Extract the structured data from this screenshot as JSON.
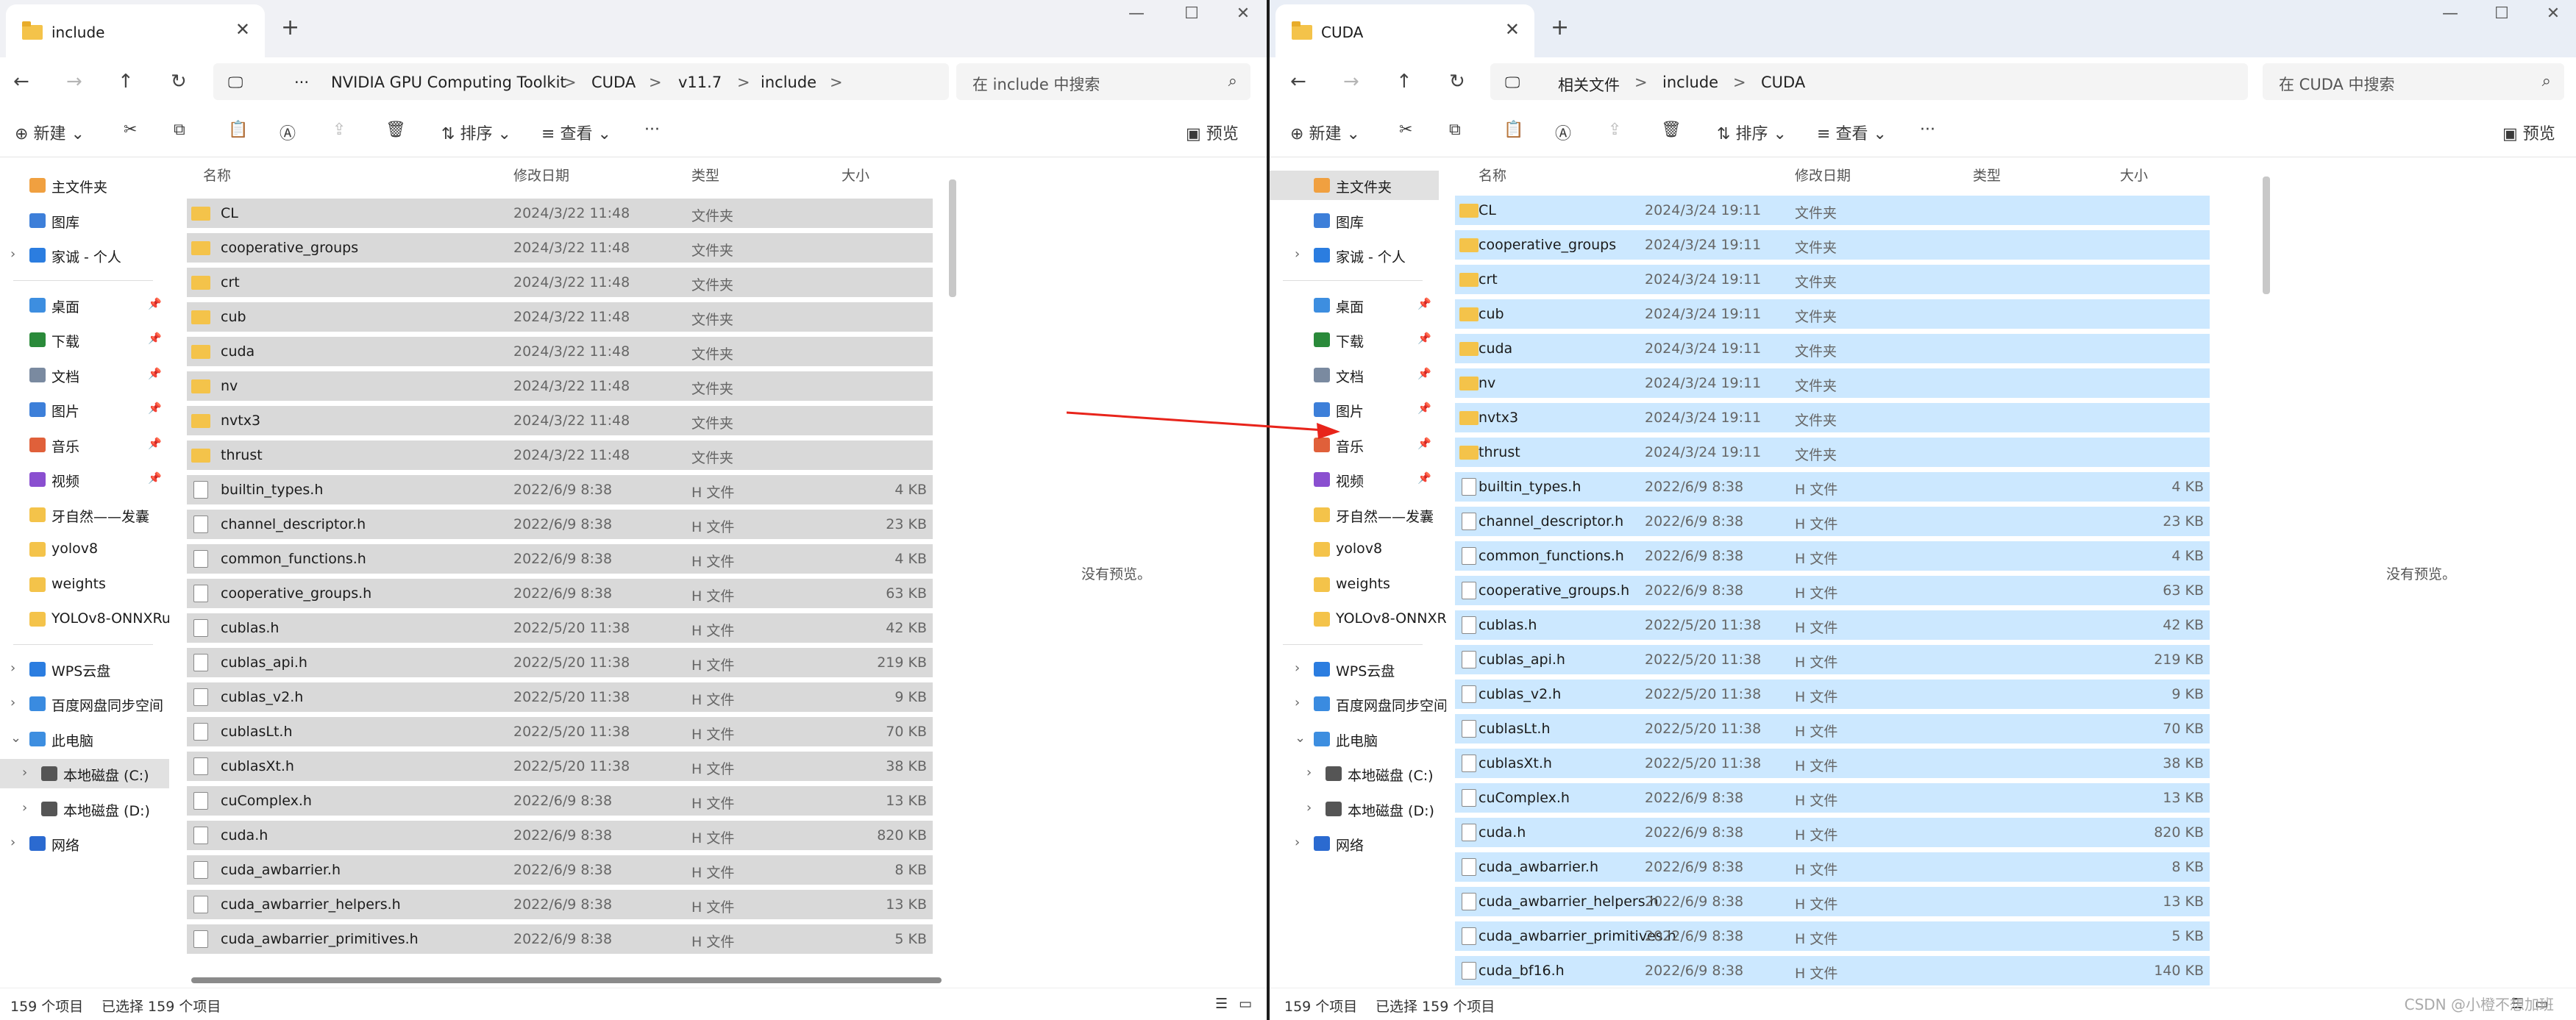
{
  "left_window": {
    "tab_title": "include",
    "breadcrumb": [
      "NVIDIA GPU Computing Toolkit",
      "CUDA",
      "v11.7",
      "include"
    ],
    "search_placeholder": "在 include 中搜索",
    "no_preview": "没有预览。",
    "status_count": "159 个项目",
    "status_selected": "已选择 159 个项目",
    "files": [
      {
        "name": "CL",
        "date": "2024/3/22 11:48",
        "type": "文件夹",
        "size": "",
        "kind": "folder"
      },
      {
        "name": "cooperative_groups",
        "date": "2024/3/22 11:48",
        "type": "文件夹",
        "size": "",
        "kind": "folder"
      },
      {
        "name": "crt",
        "date": "2024/3/22 11:48",
        "type": "文件夹",
        "size": "",
        "kind": "folder"
      },
      {
        "name": "cub",
        "date": "2024/3/22 11:48",
        "type": "文件夹",
        "size": "",
        "kind": "folder"
      },
      {
        "name": "cuda",
        "date": "2024/3/22 11:48",
        "type": "文件夹",
        "size": "",
        "kind": "folder"
      },
      {
        "name": "nv",
        "date": "2024/3/22 11:48",
        "type": "文件夹",
        "size": "",
        "kind": "folder"
      },
      {
        "name": "nvtx3",
        "date": "2024/3/22 11:48",
        "type": "文件夹",
        "size": "",
        "kind": "folder"
      },
      {
        "name": "thrust",
        "date": "2024/3/22 11:48",
        "type": "文件夹",
        "size": "",
        "kind": "folder"
      },
      {
        "name": "builtin_types.h",
        "date": "2022/6/9 8:38",
        "type": "H 文件",
        "size": "4 KB",
        "kind": "file"
      },
      {
        "name": "channel_descriptor.h",
        "date": "2022/6/9 8:38",
        "type": "H 文件",
        "size": "23 KB",
        "kind": "file"
      },
      {
        "name": "common_functions.h",
        "date": "2022/6/9 8:38",
        "type": "H 文件",
        "size": "4 KB",
        "kind": "file"
      },
      {
        "name": "cooperative_groups.h",
        "date": "2022/6/9 8:38",
        "type": "H 文件",
        "size": "63 KB",
        "kind": "file"
      },
      {
        "name": "cublas.h",
        "date": "2022/5/20 11:38",
        "type": "H 文件",
        "size": "42 KB",
        "kind": "file"
      },
      {
        "name": "cublas_api.h",
        "date": "2022/5/20 11:38",
        "type": "H 文件",
        "size": "219 KB",
        "kind": "file"
      },
      {
        "name": "cublas_v2.h",
        "date": "2022/5/20 11:38",
        "type": "H 文件",
        "size": "9 KB",
        "kind": "file"
      },
      {
        "name": "cublasLt.h",
        "date": "2022/5/20 11:38",
        "type": "H 文件",
        "size": "70 KB",
        "kind": "file"
      },
      {
        "name": "cublasXt.h",
        "date": "2022/5/20 11:38",
        "type": "H 文件",
        "size": "38 KB",
        "kind": "file"
      },
      {
        "name": "cuComplex.h",
        "date": "2022/6/9 8:38",
        "type": "H 文件",
        "size": "13 KB",
        "kind": "file"
      },
      {
        "name": "cuda.h",
        "date": "2022/6/9 8:38",
        "type": "H 文件",
        "size": "820 KB",
        "kind": "file"
      },
      {
        "name": "cuda_awbarrier.h",
        "date": "2022/6/9 8:38",
        "type": "H 文件",
        "size": "8 KB",
        "kind": "file"
      },
      {
        "name": "cuda_awbarrier_helpers.h",
        "date": "2022/6/9 8:38",
        "type": "H 文件",
        "size": "13 KB",
        "kind": "file"
      },
      {
        "name": "cuda_awbarrier_primitives.h",
        "date": "2022/6/9 8:38",
        "type": "H 文件",
        "size": "5 KB",
        "kind": "file"
      }
    ]
  },
  "right_window": {
    "tab_title": "CUDA",
    "breadcrumb": [
      "相关文件",
      "include",
      "CUDA"
    ],
    "search_placeholder": "在 CUDA 中搜索",
    "no_preview": "没有预览。",
    "status_count": "159 个项目",
    "status_selected": "已选择 159 个项目",
    "files": [
      {
        "name": "CL",
        "date": "2024/3/24 19:11",
        "type": "文件夹",
        "size": "",
        "kind": "folder"
      },
      {
        "name": "cooperative_groups",
        "date": "2024/3/24 19:11",
        "type": "文件夹",
        "size": "",
        "kind": "folder"
      },
      {
        "name": "crt",
        "date": "2024/3/24 19:11",
        "type": "文件夹",
        "size": "",
        "kind": "folder"
      },
      {
        "name": "cub",
        "date": "2024/3/24 19:11",
        "type": "文件夹",
        "size": "",
        "kind": "folder"
      },
      {
        "name": "cuda",
        "date": "2024/3/24 19:11",
        "type": "文件夹",
        "size": "",
        "kind": "folder"
      },
      {
        "name": "nv",
        "date": "2024/3/24 19:11",
        "type": "文件夹",
        "size": "",
        "kind": "folder"
      },
      {
        "name": "nvtx3",
        "date": "2024/3/24 19:11",
        "type": "文件夹",
        "size": "",
        "kind": "folder"
      },
      {
        "name": "thrust",
        "date": "2024/3/24 19:11",
        "type": "文件夹",
        "size": "",
        "kind": "folder"
      },
      {
        "name": "builtin_types.h",
        "date": "2022/6/9 8:38",
        "type": "H 文件",
        "size": "4 KB",
        "kind": "file"
      },
      {
        "name": "channel_descriptor.h",
        "date": "2022/6/9 8:38",
        "type": "H 文件",
        "size": "23 KB",
        "kind": "file"
      },
      {
        "name": "common_functions.h",
        "date": "2022/6/9 8:38",
        "type": "H 文件",
        "size": "4 KB",
        "kind": "file"
      },
      {
        "name": "cooperative_groups.h",
        "date": "2022/6/9 8:38",
        "type": "H 文件",
        "size": "63 KB",
        "kind": "file"
      },
      {
        "name": "cublas.h",
        "date": "2022/5/20 11:38",
        "type": "H 文件",
        "size": "42 KB",
        "kind": "file"
      },
      {
        "name": "cublas_api.h",
        "date": "2022/5/20 11:38",
        "type": "H 文件",
        "size": "219 KB",
        "kind": "file"
      },
      {
        "name": "cublas_v2.h",
        "date": "2022/5/20 11:38",
        "type": "H 文件",
        "size": "9 KB",
        "kind": "file"
      },
      {
        "name": "cublasLt.h",
        "date": "2022/5/20 11:38",
        "type": "H 文件",
        "size": "70 KB",
        "kind": "file"
      },
      {
        "name": "cublasXt.h",
        "date": "2022/5/20 11:38",
        "type": "H 文件",
        "size": "38 KB",
        "kind": "file"
      },
      {
        "name": "cuComplex.h",
        "date": "2022/6/9 8:38",
        "type": "H 文件",
        "size": "13 KB",
        "kind": "file"
      },
      {
        "name": "cuda.h",
        "date": "2022/6/9 8:38",
        "type": "H 文件",
        "size": "820 KB",
        "kind": "file"
      },
      {
        "name": "cuda_awbarrier.h",
        "date": "2022/6/9 8:38",
        "type": "H 文件",
        "size": "8 KB",
        "kind": "file"
      },
      {
        "name": "cuda_awbarrier_helpers.h",
        "date": "2022/6/9 8:38",
        "type": "H 文件",
        "size": "13 KB",
        "kind": "file"
      },
      {
        "name": "cuda_awbarrier_primitives.h",
        "date": "2022/6/9 8:38",
        "type": "H 文件",
        "size": "5 KB",
        "kind": "file"
      },
      {
        "name": "cuda_bf16.h",
        "date": "2022/6/9 8:38",
        "type": "H 文件",
        "size": "140 KB",
        "kind": "file"
      }
    ]
  },
  "toolbar": {
    "new": "新建",
    "sort": "排序",
    "view": "查看",
    "more": "···",
    "preview": "预览"
  },
  "columns": {
    "name": "名称",
    "date": "修改日期",
    "type": "类型",
    "size": "大小"
  },
  "sidebar": {
    "home": "主文件夹",
    "gallery": "图库",
    "family": "家诚 - 个人",
    "desktop": "桌面",
    "downloads": "下载",
    "documents": "文档",
    "pictures": "图片",
    "music": "音乐",
    "videos": "视频",
    "f1": "牙自然——发囊",
    "f2": "yolov8",
    "f3": "weights",
    "f4": "YOLOv8-ONNXRu",
    "wps": "WPS云盘",
    "baidu": "百度网盘同步空间",
    "pc": "此电脑",
    "c": "本地磁盘 (C:)",
    "d": "本地磁盘 (D:)",
    "net": "网络"
  },
  "watermark": "CSDN @小橙不想加班",
  "colors": {
    "left_selection": "#d9d9d9",
    "right_selection": "#cce8ff",
    "folder": "#f4c34a",
    "arrow": "#e8241b"
  }
}
